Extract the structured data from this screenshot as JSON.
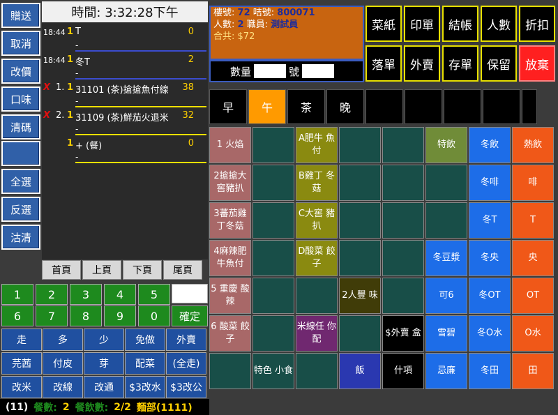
{
  "left_buttons": [
    "贈送",
    "取消",
    "改價",
    "口味",
    "清碼",
    "",
    "全選",
    "反選",
    "沽清"
  ],
  "clock": {
    "label": "時間: 3:32:28下午"
  },
  "orders": [
    {
      "time": "18:44",
      "idx": "",
      "qty": "1",
      "name": "T",
      "price": "0",
      "sub": "-",
      "line": "#3b4ccf"
    },
    {
      "time": "18:44",
      "idx": "",
      "qty": "1",
      "name": "冬T",
      "price": "2",
      "sub": "-",
      "line": "#3b4ccf"
    },
    {
      "time": "",
      "idx": "1.",
      "qty": "1",
      "name": "31101 (茶)搶搶魚付線",
      "price": "38",
      "sub": "-",
      "line": "#f0e000"
    },
    {
      "time": "",
      "idx": "2.",
      "qty": "1",
      "name": "31109 (茶)鮮茄火退米",
      "price": "32",
      "sub": "-",
      "line": "#f0e000"
    },
    {
      "time": "",
      "idx": "",
      "qty": "1",
      "name": "+ (餐)",
      "price": "0",
      "sub": "-",
      "line": "#f0e000"
    }
  ],
  "paging": [
    "首頁",
    "上頁",
    "下頁",
    "尾頁"
  ],
  "numpad": [
    "1",
    "2",
    "3",
    "4",
    "5",
    "6",
    "7",
    "8",
    "9",
    "0"
  ],
  "confirm": "確定",
  "modifiers_row1": [
    "走",
    "多",
    "少",
    "免做",
    "外賣"
  ],
  "modifiers_row2": [
    "芫茜",
    "付皮",
    "芽",
    "配菜",
    "(全走)"
  ],
  "modifiers_row3": [
    "改米",
    "改線",
    "改通",
    "$3改水",
    "$3改公"
  ],
  "status": {
    "count": "(11)",
    "meal_label": "餐數:",
    "meal_val": "2",
    "drink_label": "餐飲數:",
    "drink_val": "2/2",
    "dept": "麵部(1111)"
  },
  "info": {
    "floor_label": "樓號:",
    "floor_val": "72",
    "bell_label": "咭號:",
    "bell_val": "800071",
    "people_label": "人數:",
    "people_val": "2",
    "staff_label": "職員:",
    "staff_val": "測試員",
    "total_label": "合共:",
    "total_val": "$72",
    "qty_label": "數量",
    "no_label": "號"
  },
  "function_buttons": [
    "菜紙",
    "印單",
    "結帳",
    "人數",
    "折扣",
    "落單",
    "外賣",
    "存單",
    "保留",
    "放棄"
  ],
  "meal_tabs": [
    "早",
    "午",
    "茶",
    "晚",
    "",
    "",
    "",
    "",
    ""
  ],
  "grid": [
    [
      "1 火焰",
      "",
      "A肥牛 魚付",
      "",
      "",
      "特飲",
      "冬飲",
      "熱飲"
    ],
    [
      "2搶搶大 窖豬扒",
      "",
      "B雞丁 冬菇",
      "",
      "",
      "",
      "冬啡",
      "啡"
    ],
    [
      "3蕃茄雞 丁冬菇",
      "",
      "C大窖 豬扒",
      "",
      "",
      "",
      "冬T",
      "T"
    ],
    [
      "4麻辣肥 牛魚付",
      "",
      "D酸菜 餃子",
      "",
      "",
      "冬豆漿",
      "冬央",
      "央"
    ],
    [
      "5 重慶 酸辣",
      "",
      "",
      "2人豐 味",
      "",
      "可6",
      "冬OT",
      "OT"
    ],
    [
      "6 酸菜 餃子",
      "",
      "米線任 你配",
      "",
      "$外賣 盒",
      "雪碧",
      "冬O水",
      "O水"
    ],
    [
      "",
      "特色 小食",
      "",
      "飯",
      "什項",
      "忌廉",
      "冬田",
      "田"
    ]
  ],
  "colors": {
    "accent": "#3060a8",
    "active_tab": "#ff9a00",
    "cancel": "#ff2020"
  }
}
